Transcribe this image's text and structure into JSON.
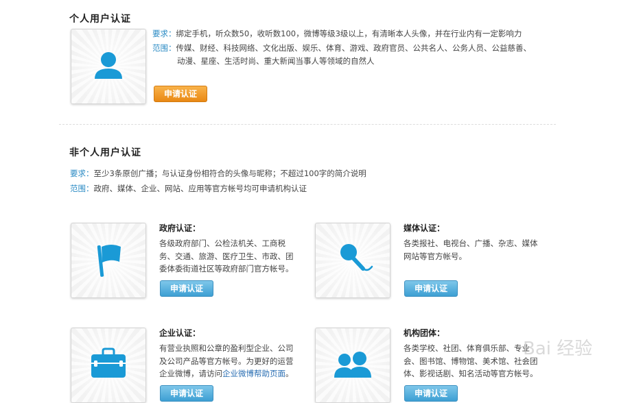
{
  "personal": {
    "title": "个人用户认证",
    "requirement_label": "要求：",
    "requirement_text": "绑定手机，听众数50，收听数100，微博等级3级以上，有清晰本人头像，并在行业内有一定影响力",
    "scope_label": "范围：",
    "scope_line1": "传媒、财经、科技网络、文化出版、娱乐、体育、游戏、政府官员、公共名人、公务人员、公益慈善、",
    "scope_line2": "动漫、星座、生活时尚、重大新闻当事人等领域的自然人",
    "button": "申请认证"
  },
  "org": {
    "title": "非个人用户认证",
    "requirement_label": "要求：",
    "requirement_text": "至少3条原创广播；与认证身份相符合的头像与昵称；不超过100字的简介说明",
    "scope_label": "范围：",
    "scope_text": "政府、媒体、企业、网站、应用等官方帐号均可申请机构认证"
  },
  "cards": {
    "gov": {
      "title": "政府认证：",
      "lines": [
        "各级政府部门、公检法机关、工商税",
        "务、交通、旅游、医疗卫生、市政、团",
        "委体委街道社区等政府部门官方帐号。"
      ],
      "button": "申请认证"
    },
    "media": {
      "title": "媒体认证：",
      "lines": [
        "各类报社、电视台、广播、杂志、媒体",
        "网站等官方帐号。"
      ],
      "button": "申请认证"
    },
    "enterprise": {
      "title": "企业认证：",
      "line1": "有营业执照和公章的盈利型企业、公司",
      "line2": "及公司产品等官方帐号。为更好的运营",
      "line3_prefix": "企业微博，请访问",
      "line3_link": "企业微博帮助页面",
      "line3_suffix": "。",
      "button": "申请认证"
    },
    "group": {
      "title": "机构团体：",
      "lines": [
        "各类学校、社团、体育俱乐部、专业",
        "会、图书馆、博物馆、美术馆、社会团",
        "体、影视话剧、知名活动等官方帐号。"
      ],
      "button": "申请认证"
    }
  },
  "watermark": "Bai 经验",
  "colors": {
    "label_blue": "#2b8bc4",
    "icon_blue": "#1a9ad6",
    "orange_button": "#f0982a",
    "blue_button": "#4aa6d8"
  }
}
